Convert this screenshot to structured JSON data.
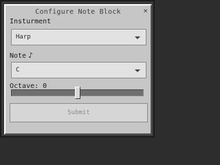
{
  "dialog": {
    "title": "Configure Note Block",
    "close_glyph": "×"
  },
  "instrument": {
    "label": "Insturment",
    "value": "Harp"
  },
  "note": {
    "label": "Note",
    "icon": "♪",
    "value": "C"
  },
  "octave": {
    "label": "Octave: 0",
    "level_fraction": 0.5
  },
  "submit": {
    "label": "Submit"
  }
}
